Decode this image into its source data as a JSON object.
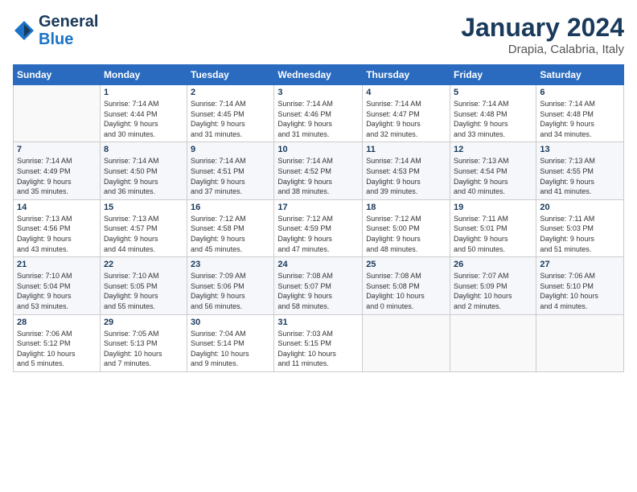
{
  "header": {
    "logo_line1": "General",
    "logo_line2": "Blue",
    "title": "January 2024",
    "subtitle": "Drapia, Calabria, Italy"
  },
  "columns": [
    "Sunday",
    "Monday",
    "Tuesday",
    "Wednesday",
    "Thursday",
    "Friday",
    "Saturday"
  ],
  "weeks": [
    [
      {
        "day": "",
        "info": ""
      },
      {
        "day": "1",
        "info": "Sunrise: 7:14 AM\nSunset: 4:44 PM\nDaylight: 9 hours\nand 30 minutes."
      },
      {
        "day": "2",
        "info": "Sunrise: 7:14 AM\nSunset: 4:45 PM\nDaylight: 9 hours\nand 31 minutes."
      },
      {
        "day": "3",
        "info": "Sunrise: 7:14 AM\nSunset: 4:46 PM\nDaylight: 9 hours\nand 31 minutes."
      },
      {
        "day": "4",
        "info": "Sunrise: 7:14 AM\nSunset: 4:47 PM\nDaylight: 9 hours\nand 32 minutes."
      },
      {
        "day": "5",
        "info": "Sunrise: 7:14 AM\nSunset: 4:48 PM\nDaylight: 9 hours\nand 33 minutes."
      },
      {
        "day": "6",
        "info": "Sunrise: 7:14 AM\nSunset: 4:48 PM\nDaylight: 9 hours\nand 34 minutes."
      }
    ],
    [
      {
        "day": "7",
        "info": "Sunrise: 7:14 AM\nSunset: 4:49 PM\nDaylight: 9 hours\nand 35 minutes."
      },
      {
        "day": "8",
        "info": "Sunrise: 7:14 AM\nSunset: 4:50 PM\nDaylight: 9 hours\nand 36 minutes."
      },
      {
        "day": "9",
        "info": "Sunrise: 7:14 AM\nSunset: 4:51 PM\nDaylight: 9 hours\nand 37 minutes."
      },
      {
        "day": "10",
        "info": "Sunrise: 7:14 AM\nSunset: 4:52 PM\nDaylight: 9 hours\nand 38 minutes."
      },
      {
        "day": "11",
        "info": "Sunrise: 7:14 AM\nSunset: 4:53 PM\nDaylight: 9 hours\nand 39 minutes."
      },
      {
        "day": "12",
        "info": "Sunrise: 7:13 AM\nSunset: 4:54 PM\nDaylight: 9 hours\nand 40 minutes."
      },
      {
        "day": "13",
        "info": "Sunrise: 7:13 AM\nSunset: 4:55 PM\nDaylight: 9 hours\nand 41 minutes."
      }
    ],
    [
      {
        "day": "14",
        "info": "Sunrise: 7:13 AM\nSunset: 4:56 PM\nDaylight: 9 hours\nand 43 minutes."
      },
      {
        "day": "15",
        "info": "Sunrise: 7:13 AM\nSunset: 4:57 PM\nDaylight: 9 hours\nand 44 minutes."
      },
      {
        "day": "16",
        "info": "Sunrise: 7:12 AM\nSunset: 4:58 PM\nDaylight: 9 hours\nand 45 minutes."
      },
      {
        "day": "17",
        "info": "Sunrise: 7:12 AM\nSunset: 4:59 PM\nDaylight: 9 hours\nand 47 minutes."
      },
      {
        "day": "18",
        "info": "Sunrise: 7:12 AM\nSunset: 5:00 PM\nDaylight: 9 hours\nand 48 minutes."
      },
      {
        "day": "19",
        "info": "Sunrise: 7:11 AM\nSunset: 5:01 PM\nDaylight: 9 hours\nand 50 minutes."
      },
      {
        "day": "20",
        "info": "Sunrise: 7:11 AM\nSunset: 5:03 PM\nDaylight: 9 hours\nand 51 minutes."
      }
    ],
    [
      {
        "day": "21",
        "info": "Sunrise: 7:10 AM\nSunset: 5:04 PM\nDaylight: 9 hours\nand 53 minutes."
      },
      {
        "day": "22",
        "info": "Sunrise: 7:10 AM\nSunset: 5:05 PM\nDaylight: 9 hours\nand 55 minutes."
      },
      {
        "day": "23",
        "info": "Sunrise: 7:09 AM\nSunset: 5:06 PM\nDaylight: 9 hours\nand 56 minutes."
      },
      {
        "day": "24",
        "info": "Sunrise: 7:08 AM\nSunset: 5:07 PM\nDaylight: 9 hours\nand 58 minutes."
      },
      {
        "day": "25",
        "info": "Sunrise: 7:08 AM\nSunset: 5:08 PM\nDaylight: 10 hours\nand 0 minutes."
      },
      {
        "day": "26",
        "info": "Sunrise: 7:07 AM\nSunset: 5:09 PM\nDaylight: 10 hours\nand 2 minutes."
      },
      {
        "day": "27",
        "info": "Sunrise: 7:06 AM\nSunset: 5:10 PM\nDaylight: 10 hours\nand 4 minutes."
      }
    ],
    [
      {
        "day": "28",
        "info": "Sunrise: 7:06 AM\nSunset: 5:12 PM\nDaylight: 10 hours\nand 5 minutes."
      },
      {
        "day": "29",
        "info": "Sunrise: 7:05 AM\nSunset: 5:13 PM\nDaylight: 10 hours\nand 7 minutes."
      },
      {
        "day": "30",
        "info": "Sunrise: 7:04 AM\nSunset: 5:14 PM\nDaylight: 10 hours\nand 9 minutes."
      },
      {
        "day": "31",
        "info": "Sunrise: 7:03 AM\nSunset: 5:15 PM\nDaylight: 10 hours\nand 11 minutes."
      },
      {
        "day": "",
        "info": ""
      },
      {
        "day": "",
        "info": ""
      },
      {
        "day": "",
        "info": ""
      }
    ]
  ]
}
